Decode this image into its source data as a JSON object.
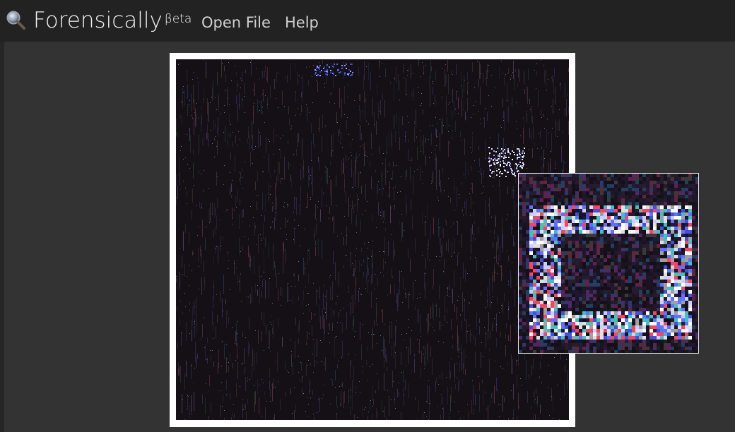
{
  "app": {
    "title": "Forensically",
    "superscript": "βeta"
  },
  "nav": {
    "open_file": "Open File",
    "help": "Help"
  },
  "icons": {
    "logo": "magnifier-icon"
  },
  "colors": {
    "topbar": "#222222",
    "workspace": "#333333",
    "image_frame": "#ffffff",
    "loupe_border": "#e8e8e8"
  },
  "view": {
    "image": "error-level-noise-map",
    "loupe": "magnified-region"
  }
}
